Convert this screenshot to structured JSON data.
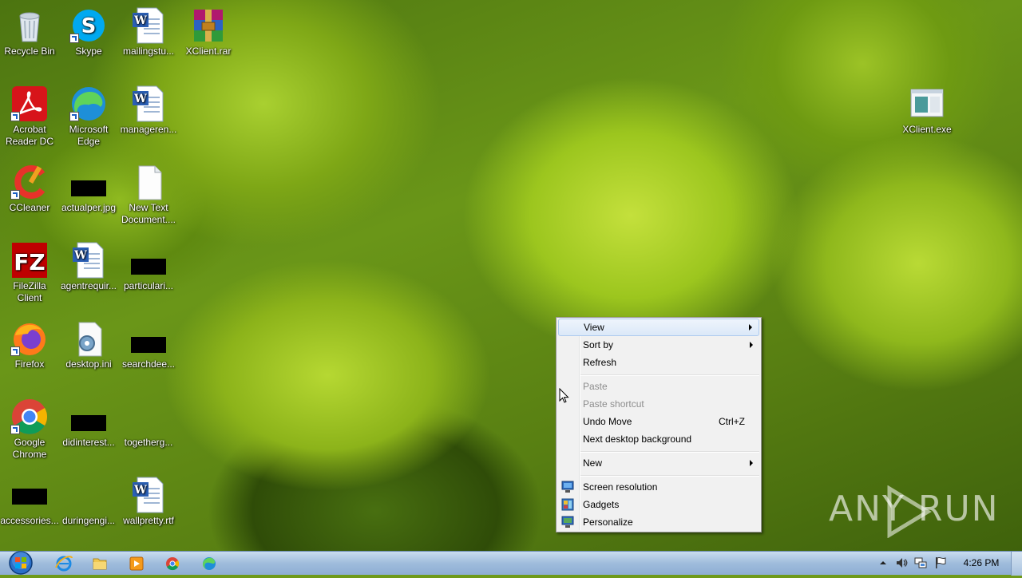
{
  "desktop": {
    "icons": [
      {
        "label": "Recycle Bin",
        "icon": "recycle-bin-icon"
      },
      {
        "label": "Skype",
        "icon": "skype-icon"
      },
      {
        "label": "mailingstu...",
        "icon": "word-document-icon"
      },
      {
        "label": "XClient.rar",
        "icon": "winrar-archive-icon"
      },
      {
        "label": "Acrobat Reader DC",
        "icon": "acrobat-reader-icon"
      },
      {
        "label": "Microsoft Edge",
        "icon": "edge-icon"
      },
      {
        "label": "manageren...",
        "icon": "word-document-icon"
      },
      {
        "label": "XClient.exe",
        "icon": "application-exe-icon"
      },
      {
        "label": "CCleaner",
        "icon": "ccleaner-icon"
      },
      {
        "label": "actualper.jpg",
        "icon": "image-file-icon"
      },
      {
        "label": "New Text Document....",
        "icon": "text-document-icon"
      },
      {
        "label": "FileZilla Client",
        "icon": "filezilla-icon"
      },
      {
        "label": "agentrequir...",
        "icon": "word-document-icon"
      },
      {
        "label": "particulari...",
        "icon": "image-file-icon"
      },
      {
        "label": "Firefox",
        "icon": "firefox-icon"
      },
      {
        "label": "desktop.ini",
        "icon": "settings-file-icon"
      },
      {
        "label": "searchdee...",
        "icon": "image-file-icon"
      },
      {
        "label": "Google Chrome",
        "icon": "chrome-icon"
      },
      {
        "label": "didinterest...",
        "icon": "image-file-icon"
      },
      {
        "label": "togetherg...",
        "icon": "blank-file-icon"
      },
      {
        "label": "accessories...",
        "icon": "image-file-icon"
      },
      {
        "label": "duringengi...",
        "icon": "blank-file-icon"
      },
      {
        "label": "wallpretty.rtf",
        "icon": "word-document-icon"
      }
    ]
  },
  "context_menu": {
    "view": "View",
    "sort_by": "Sort by",
    "refresh": "Refresh",
    "paste": "Paste",
    "paste_shortcut": "Paste shortcut",
    "undo_move": "Undo Move",
    "undo_shortcut": "Ctrl+Z",
    "next_background": "Next desktop background",
    "new": "New",
    "screen_resolution": "Screen resolution",
    "gadgets": "Gadgets",
    "personalize": "Personalize"
  },
  "watermark": "ANY RUN",
  "taskbar": {
    "pinned": [
      "start-orb-icon",
      "internet-explorer-icon",
      "file-explorer-icon",
      "media-player-icon",
      "chrome-icon",
      "edge-icon"
    ],
    "clock": "4:26 PM"
  },
  "colors": {
    "menu_bg": "#f1f1f1",
    "menu_highlight": "#dbe8f8",
    "taskbar": "#9fbcdc"
  }
}
